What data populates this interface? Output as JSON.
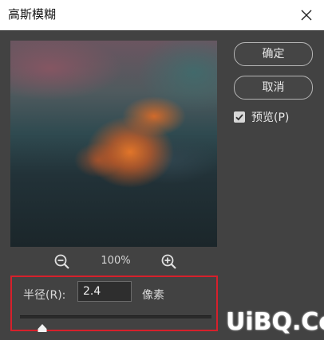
{
  "window": {
    "title": "高斯模糊",
    "close_icon": "close-icon"
  },
  "preview": {
    "zoom_level": "100%",
    "zoom_out_icon": "zoom-out-icon",
    "zoom_in_icon": "zoom-in-icon"
  },
  "buttons": {
    "ok_label": "确定",
    "cancel_label": "取消"
  },
  "preview_toggle": {
    "label": "预览(P)",
    "checked": true
  },
  "radius": {
    "label": "半径(R):",
    "value": "2.4",
    "unit": "像素",
    "slider_fraction": 0.12
  },
  "watermark": {
    "text": "UiBQ.CoM"
  },
  "colors": {
    "highlight_border": "#d6202b",
    "dialog_bg": "#424242",
    "titlebar_bg": "#ffffff"
  }
}
